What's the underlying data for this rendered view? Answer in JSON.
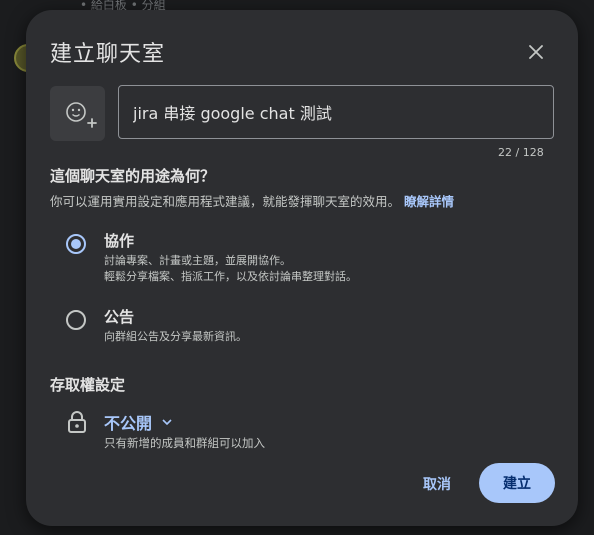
{
  "background": {
    "peek_text": "• 給白板 • 分組"
  },
  "dialog": {
    "title": "建立聊天室",
    "name_input": {
      "value": "jira 串接 google chat 測試",
      "char_count": "22 / 128"
    },
    "purpose": {
      "heading": "這個聊天室的用途為何？",
      "description": "你可以運用實用設定和應用程式建議，就能發揮聊天室的效用。",
      "learn_more": "瞭解詳情",
      "options": [
        {
          "title": "協作",
          "description": "討論專案、計畫或主題，並展開協作。\n輕鬆分享檔案、指派工作，以及依討論串整理對話。",
          "selected": true
        },
        {
          "title": "公告",
          "description": "向群組公告及分享最新資訊。",
          "selected": false
        }
      ]
    },
    "access": {
      "heading": "存取權設定",
      "value": "不公開",
      "description": "只有新增的成員和群組可以加入"
    },
    "buttons": {
      "cancel": "取消",
      "create": "建立"
    }
  },
  "colors": {
    "accent": "#a8c7fa",
    "dialog_bg": "#2d2e31",
    "text_primary": "#e3e3e3",
    "text_secondary": "#c4c7c5"
  },
  "icons": {
    "close": "close-icon",
    "emoji": "add-emoji-icon",
    "lock": "lock-icon",
    "chevron": "chevron-down-icon"
  }
}
